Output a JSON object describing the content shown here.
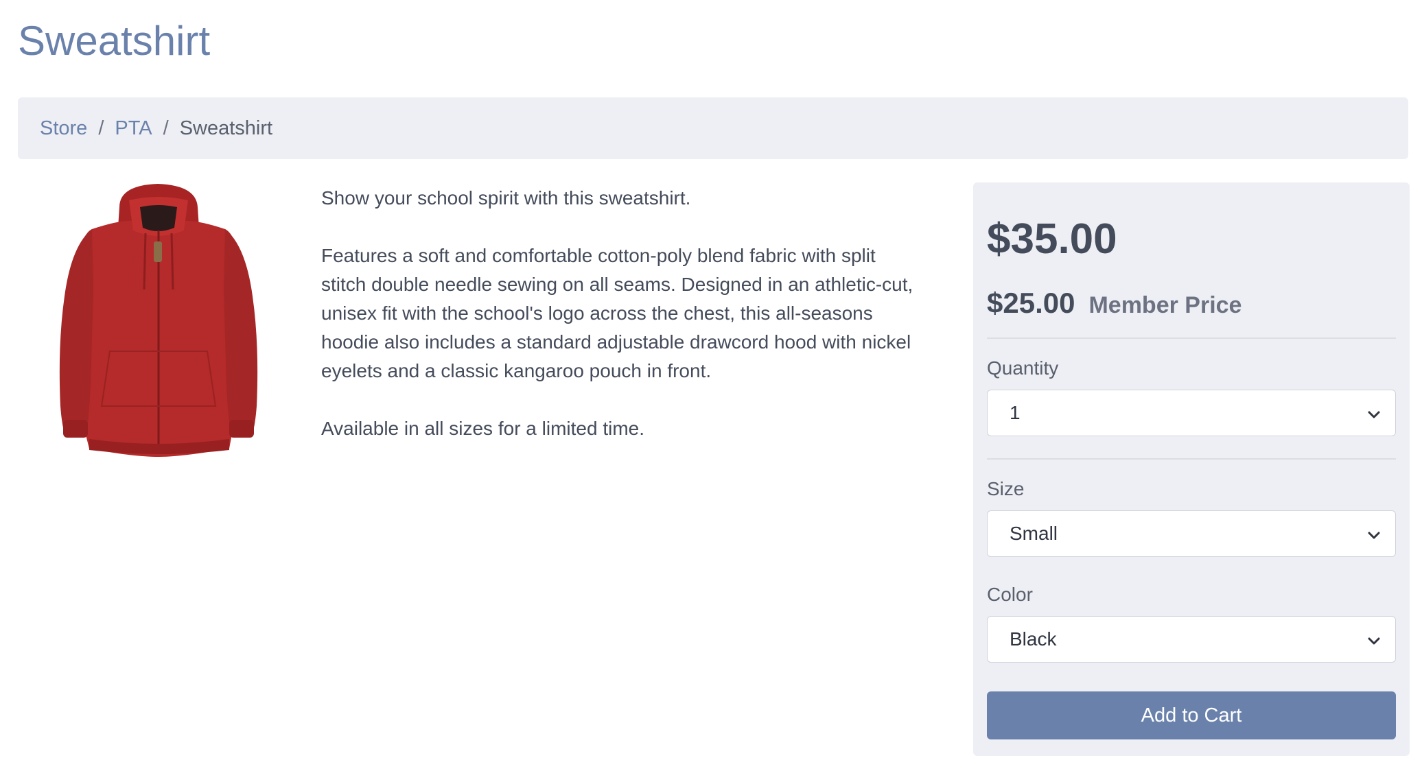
{
  "page": {
    "title": "Sweatshirt"
  },
  "breadcrumb": {
    "items": [
      {
        "label": "Store"
      },
      {
        "label": "PTA"
      },
      {
        "label": "Sweatshirt"
      }
    ],
    "separator": "/"
  },
  "product": {
    "image_icon": "red-hoodie-image",
    "image_color": "#b52a2a",
    "description": [
      "Show your school spirit with this sweatshirt.",
      "Features a soft and comfortable cotton-poly blend fabric with split stitch double needle sewing on all seams.  Designed in an athletic-cut, unisex fit with the school's logo across the chest, this all-seasons hoodie also includes a standard adjustable drawcord hood with nickel eyelets and a classic kangaroo pouch in front.",
      "Available in all sizes for a limited time."
    ]
  },
  "purchase": {
    "price": "$35.00",
    "member_price": "$25.00",
    "member_label": "Member Price",
    "quantity": {
      "label": "Quantity",
      "value": "1"
    },
    "size": {
      "label": "Size",
      "value": "Small"
    },
    "color": {
      "label": "Color",
      "value": "Black"
    },
    "add_to_cart_label": "Add to Cart"
  },
  "colors": {
    "accent": "#6a82ab",
    "panel_bg": "#eeeff4",
    "text": "#444b5a"
  }
}
